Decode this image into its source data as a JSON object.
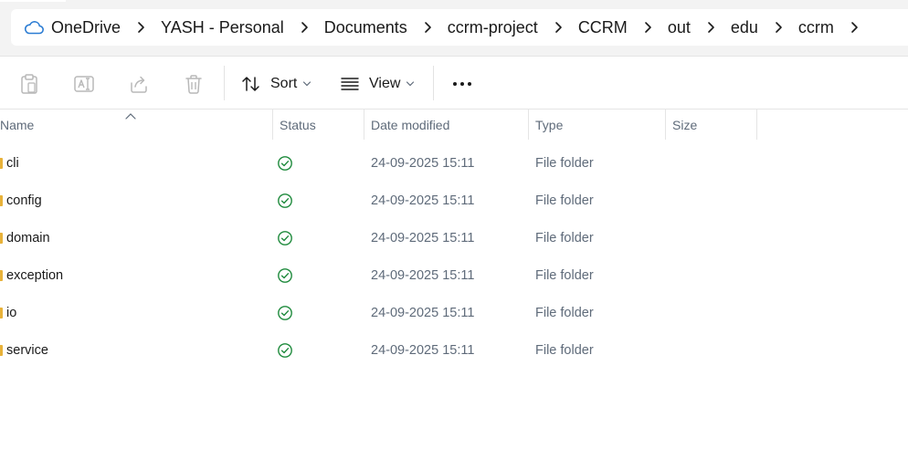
{
  "breadcrumb": {
    "items": [
      "OneDrive",
      "YASH - Personal",
      "Documents",
      "ccrm-project",
      "CCRM",
      "out",
      "edu",
      "ccrm"
    ],
    "root_icon": "cloud-icon",
    "separator_icon": "chevron-right-icon"
  },
  "toolbar": {
    "icons": [
      "paste-icon",
      "rename-icon",
      "share-icon",
      "delete-icon"
    ],
    "sort_label": "Sort",
    "view_label": "View",
    "more_icon": "more-icon"
  },
  "columns": {
    "name": "Name",
    "status": "Status",
    "date": "Date modified",
    "type": "Type",
    "size": "Size"
  },
  "rows": [
    {
      "name": "cli",
      "status": "available",
      "date": "24-09-2025 15:11",
      "type": "File folder",
      "size": ""
    },
    {
      "name": "config",
      "status": "available",
      "date": "24-09-2025 15:11",
      "type": "File folder",
      "size": ""
    },
    {
      "name": "domain",
      "status": "available",
      "date": "24-09-2025 15:11",
      "type": "File folder",
      "size": ""
    },
    {
      "name": "exception",
      "status": "available",
      "date": "24-09-2025 15:11",
      "type": "File folder",
      "size": ""
    },
    {
      "name": "io",
      "status": "available",
      "date": "24-09-2025 15:11",
      "type": "File folder",
      "size": ""
    },
    {
      "name": "service",
      "status": "available",
      "date": "24-09-2025 15:11",
      "type": "File folder",
      "size": ""
    }
  ],
  "colors": {
    "cloud": "#2b7cd3",
    "status_ok": "#1e8a3c",
    "folder": "#e8b23a",
    "muted_text": "#5f6b7a"
  }
}
